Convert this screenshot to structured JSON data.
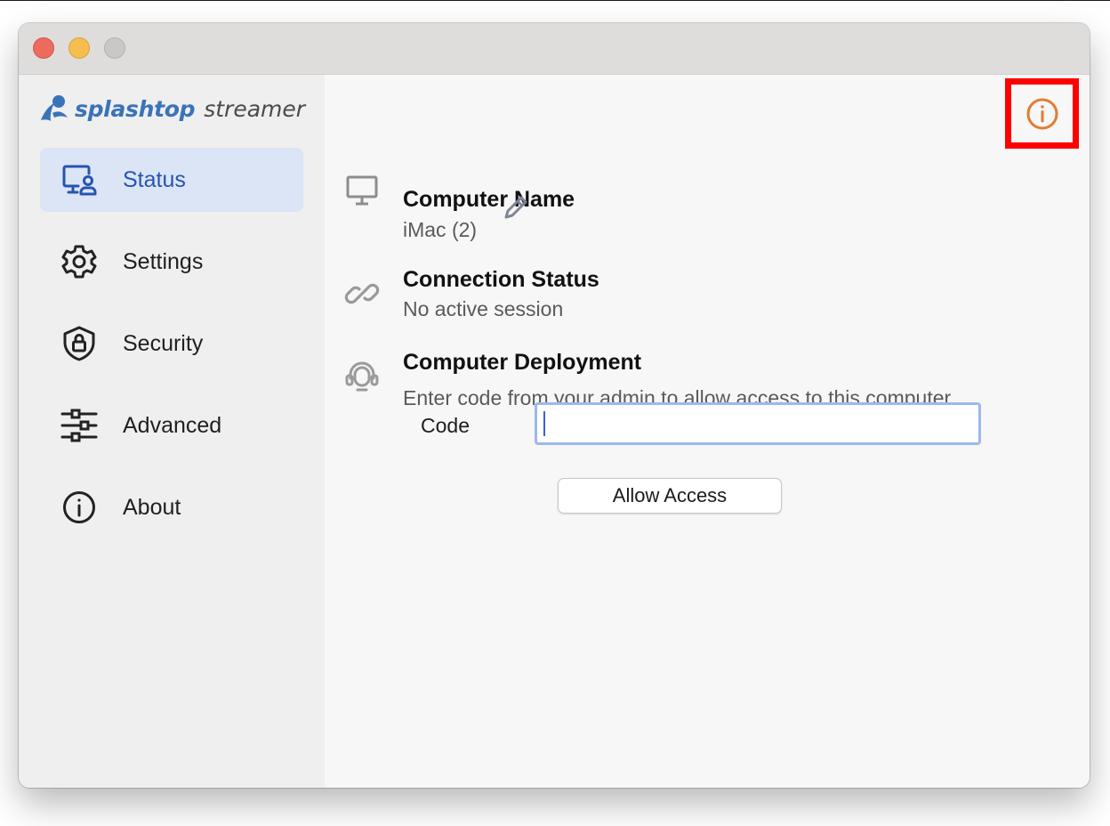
{
  "window": {
    "controls": [
      "close",
      "minimize",
      "zoom"
    ]
  },
  "sidebar": {
    "logo": {
      "brand": "splashtop",
      "product": "streamer"
    },
    "items": [
      {
        "label": "Status",
        "icon": "monitor-user-icon",
        "active": true
      },
      {
        "label": "Settings",
        "icon": "gear-icon",
        "active": false
      },
      {
        "label": "Security",
        "icon": "shield-lock-icon",
        "active": false
      },
      {
        "label": "Advanced",
        "icon": "sliders-icon",
        "active": false
      },
      {
        "label": "About",
        "icon": "info-circle-icon",
        "active": false
      }
    ]
  },
  "main": {
    "info_icon": "info-circle-icon",
    "computer_name": {
      "title": "Computer Name",
      "value": "iMac (2)"
    },
    "connection_status": {
      "title": "Connection Status",
      "value": "No active session"
    },
    "deployment": {
      "title": "Computer Deployment",
      "description": "Enter code from your admin to allow access to this computer.",
      "code_label": "Code",
      "code_value": "",
      "button_label": "Allow Access"
    }
  },
  "colors": {
    "accent": "#2754b0",
    "active_bg": "#dbe5f6",
    "info_icon": "#e27b33",
    "highlight_box": "#ff0000",
    "logo_blue": "#3a73b8"
  }
}
